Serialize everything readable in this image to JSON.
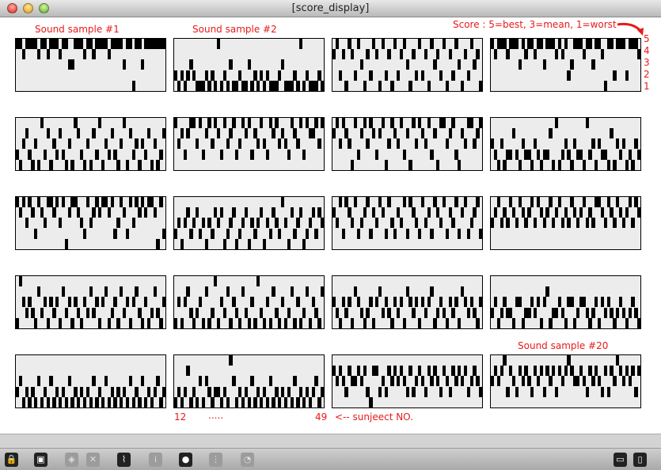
{
  "window": {
    "title": "[score_display]"
  },
  "labels": {
    "sample1": "Sound sample #1",
    "sample2": "Sound sample #2",
    "sample20": "Sound sample #20",
    "legend": "Score : 5=best, 3=mean, 1=worst",
    "subject_start": "12",
    "ellipsis": ".....",
    "subject_end": "49",
    "subject_note": "<-- sunjeect NO."
  },
  "score_axis": [
    "5",
    "4",
    "3",
    "2",
    "1"
  ],
  "accent_color": "#e8191a",
  "panels": [
    "5545555455455545533555455455554555535515535555555",
    "2121232111212151213112113121212111231112151211121",
    "4524154253142541524152453142524153425142531425341",
    "5455545553545545535554545235554553554155255525554",
    "2134213152413242131542131425132421351423132413124",
    "5342455352453542534523545243532545343254352544535",
    "4535431524535424513543524153543524155345214355345",
    "3213122421322132122415123213221523132214132312132",
    "5453542543554535145543253454554523542535454554152",
    "2313423423132434123412341323413243253142341234243",
    "4352543523452435425324352543253425435243524523452",
    "3453435435434535434534534354345343554354354345354",
    "1532321423132314231321324231341231423134213124213",
    "1313421231412513241321421315213142131241312413214",
    "3213231432123134232132314323132341232132314323213",
    "2312322133122323134122321331233212313232123212321",
    "2312121312131212131212121312131212121312131212312",
    "1212412131321221215312121312121312121213121212312",
    "4343243343421442324343432423432434324324343423432",
    "3434524324343243424342434543343243432424354343424"
  ],
  "toolbar": [
    "lock-icon",
    "new-object-icon",
    "patcher-icon",
    "close-icon",
    "presentation-icon",
    "info-icon",
    "connect-icon",
    "grid-icon",
    "clue-icon",
    "split-horizontal-icon",
    "split-vertical-icon"
  ]
}
